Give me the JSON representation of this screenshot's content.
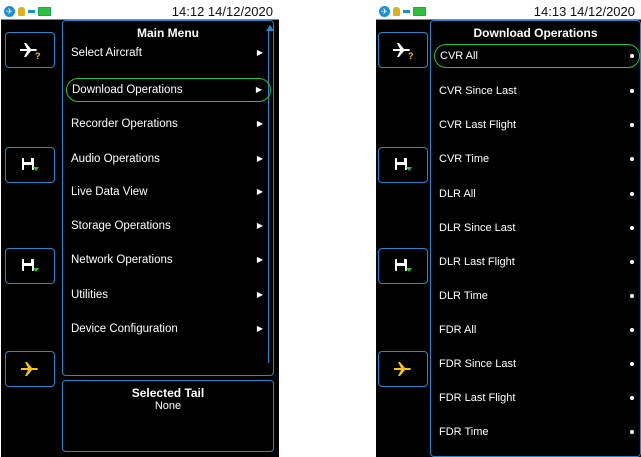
{
  "left_screen": {
    "status_time": "14:12 14/12/2020",
    "menu_title": "Main Menu",
    "menu_items": [
      {
        "label": "Select Aircraft"
      },
      {
        "label": "Download Operations"
      },
      {
        "label": "Recorder Operations"
      },
      {
        "label": "Audio Operations"
      },
      {
        "label": "Live Data View"
      },
      {
        "label": "Storage Operations"
      },
      {
        "label": "Network Operations"
      },
      {
        "label": "Utilities"
      },
      {
        "label": "Device Configuration"
      }
    ],
    "selected_item": "Download Operations",
    "tail_title": "Selected Tail",
    "tail_value": "None"
  },
  "right_screen": {
    "status_time": "14:13 14/12/2020",
    "menu_title": "Download Operations",
    "menu_items": [
      {
        "label": "CVR All"
      },
      {
        "label": "CVR Since Last"
      },
      {
        "label": "CVR Last Flight"
      },
      {
        "label": "CVR Time"
      },
      {
        "label": "DLR All"
      },
      {
        "label": "DLR Since Last"
      },
      {
        "label": "DLR Last Flight"
      },
      {
        "label": "DLR Time"
      },
      {
        "label": "FDR All"
      },
      {
        "label": "FDR Since Last"
      },
      {
        "label": "FDR Last Flight"
      },
      {
        "label": "FDR Time"
      }
    ],
    "selected_item": "CVR All"
  },
  "side_buttons": [
    {
      "icon": "aircraft-select-icon"
    },
    {
      "icon": "download-disk-icon"
    },
    {
      "icon": "download-disk-icon"
    },
    {
      "icon": "aircraft-icon"
    }
  ],
  "colors": {
    "background": "#000000",
    "border": "#2a86c8",
    "selection": "#28c62e",
    "status_bar": "#ffffff",
    "text": "#ffffff",
    "accent_yellow": "#f0c419",
    "accent_green": "#2fbf3a"
  }
}
